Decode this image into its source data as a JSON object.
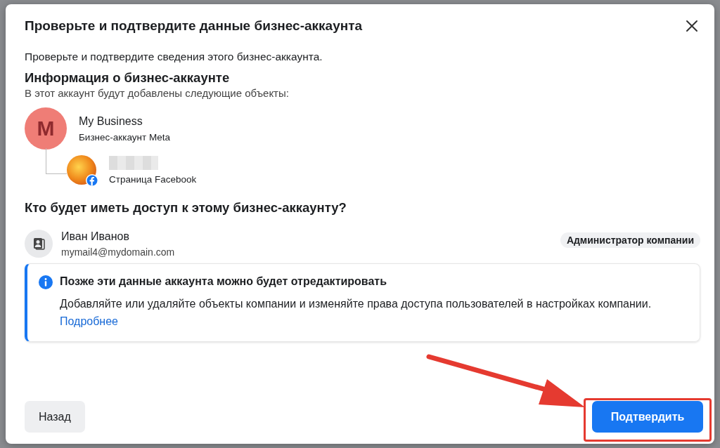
{
  "dialog": {
    "title": "Проверьте и подтвердите данные бизнес-аккаунта",
    "intro": "Проверьте и подтвердите сведения этого бизнес-аккаунта.",
    "info_section": {
      "heading": "Информация о бизнес-аккаунте",
      "subtitle": "В этот аккаунт будут добавлены следующие объекты:",
      "account": {
        "initial": "M",
        "name": "My Business",
        "type": "Бизнес-аккаунт Meta"
      },
      "assets": [
        {
          "type": "Страница Facebook"
        }
      ]
    },
    "access_section": {
      "heading": "Кто будет иметь доступ к этому бизнес-аккаунту?",
      "people": [
        {
          "name": "Иван Иванов",
          "email": "mymail4@mydomain.com",
          "role": "Администратор компании"
        }
      ]
    },
    "notice": {
      "title": "Позже эти данные аккаунта можно будет отредактировать",
      "text": "Добавляйте или удаляйте объекты компании и изменяйте права доступа пользователей в настройках компании.",
      "link": "Подробнее"
    },
    "buttons": [
      {
        "label": "Назад",
        "kind": "secondary"
      },
      {
        "label": "Подтвердить",
        "kind": "primary"
      }
    ]
  }
}
